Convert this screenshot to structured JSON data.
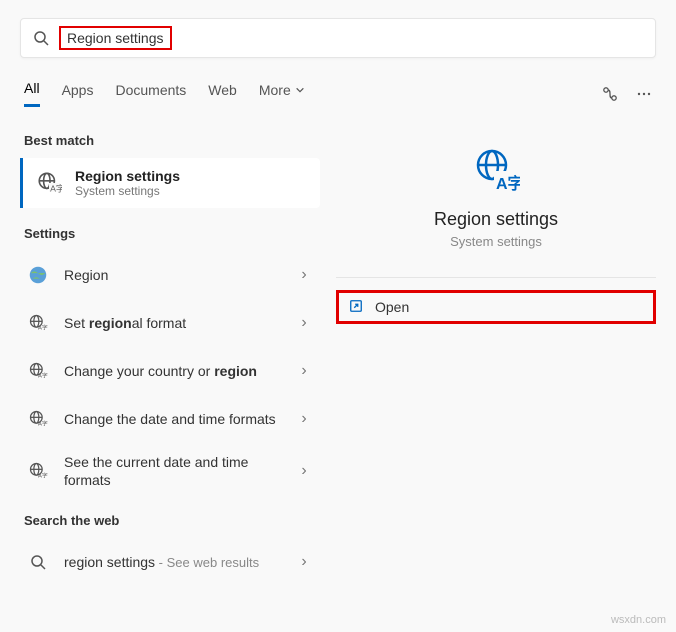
{
  "search": {
    "query": "Region settings"
  },
  "tabs": {
    "all": "All",
    "apps": "Apps",
    "documents": "Documents",
    "web": "Web",
    "more": "More"
  },
  "left": {
    "best_match_label": "Best match",
    "best_match": {
      "title": "Region settings",
      "sub": "System settings"
    },
    "settings_label": "Settings",
    "items": {
      "region": "Region",
      "regional_format_pre": "Set ",
      "regional_format_b": "region",
      "regional_format_post": "al format",
      "country_pre": "Change your country or ",
      "country_b": "region",
      "datetime": "Change the date and time formats",
      "currenttime": "See the current date and time formats"
    },
    "web_label": "Search the web",
    "web": {
      "text": "region settings",
      "sub": " - See web results"
    }
  },
  "right": {
    "title": "Region settings",
    "sub": "System settings",
    "open": "Open"
  },
  "watermark": "wsxdn.com"
}
